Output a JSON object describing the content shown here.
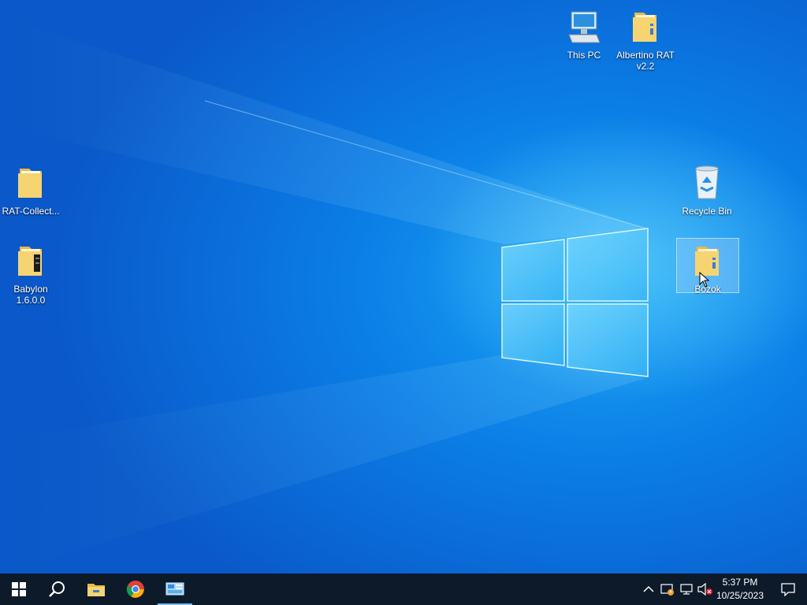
{
  "desktop": {
    "icons": [
      {
        "label": "This PC",
        "icon": "computer-icon"
      },
      {
        "label": "Albertino RAT v2.2",
        "icon": "folder-icon"
      },
      {
        "label": "RAT-Collect...",
        "icon": "folder-icon"
      },
      {
        "label": "Recycle Bin",
        "icon": "recycle-bin-icon"
      },
      {
        "label": "Babylon 1.6.0.0",
        "icon": "folder-icon"
      },
      {
        "label": "Bozok",
        "icon": "folder-icon",
        "selected": true
      }
    ]
  },
  "taskbar": {
    "buttons": [
      {
        "name": "start",
        "icon": "windows-start-icon"
      },
      {
        "name": "search",
        "icon": "search-icon"
      },
      {
        "name": "file-explorer",
        "icon": "file-explorer-icon"
      },
      {
        "name": "chrome",
        "icon": "chrome-icon"
      },
      {
        "name": "remote-desktop",
        "icon": "remote-desktop-icon",
        "active": true
      }
    ],
    "tray": {
      "icons": [
        "chevron-up-icon",
        "security-icon",
        "network-icon",
        "volume-muted-icon"
      ],
      "time": "5:37 PM",
      "date": "10/25/2023",
      "notification_icon": "action-center-icon"
    }
  },
  "colors": {
    "taskbar_bg": "#0d1a2a",
    "desktop_light": "#1aa6f5",
    "desktop_dark": "#0a58c9",
    "accent": "#76b9ed"
  }
}
